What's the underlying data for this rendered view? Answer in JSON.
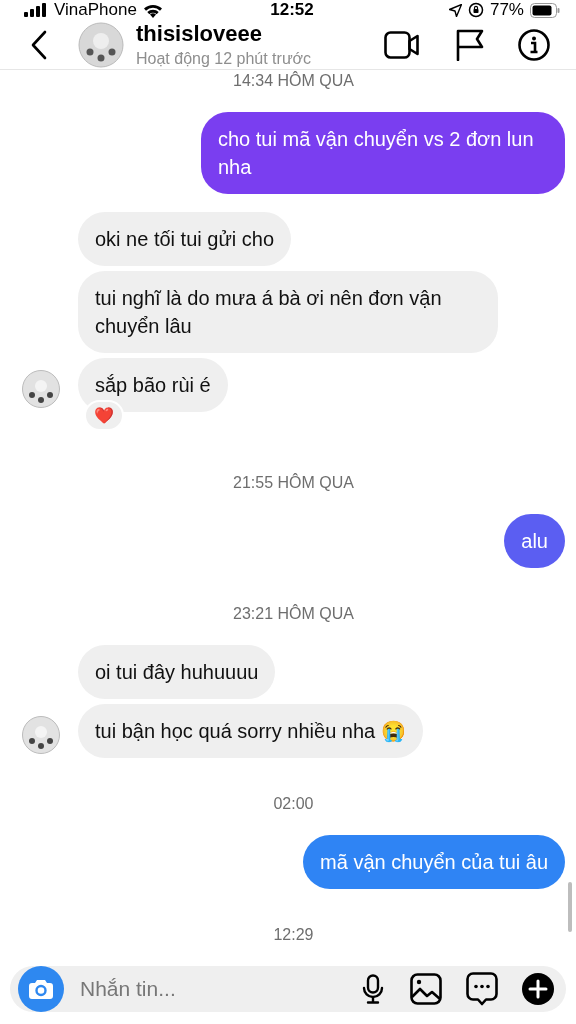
{
  "status_bar": {
    "carrier": "VinaPhone",
    "time": "12:52",
    "battery": "77%"
  },
  "header": {
    "name": "thisisloveee",
    "activity": "Hoạt động 12 phút trước"
  },
  "messages": [
    {
      "kind": "timestamp",
      "text": "14:34 HÔM QUA"
    },
    {
      "kind": "sent",
      "text": "cho tui mã vận chuyển vs 2 đơn lun nha",
      "color": "#7a3ef0"
    },
    {
      "kind": "received",
      "text": "oki ne tối tui gửi cho",
      "avatar": false
    },
    {
      "kind": "received",
      "text": "tui nghĩ là do mưa á bà ơi nên đơn vận chuyển lâu",
      "avatar": false
    },
    {
      "kind": "received",
      "text": "sắp bão rùi é",
      "avatar": true,
      "reaction": "❤️"
    },
    {
      "kind": "timestamp",
      "text": "21:55 HÔM QUA"
    },
    {
      "kind": "sent",
      "text": "alu",
      "color": "#5b5ef2"
    },
    {
      "kind": "timestamp",
      "text": "23:21 HÔM QUA"
    },
    {
      "kind": "received",
      "text": "oi tui đây huhuuuu",
      "avatar": false
    },
    {
      "kind": "received",
      "text": "tui bận học quá sorry nhiều nha 😭",
      "avatar": true
    },
    {
      "kind": "timestamp",
      "text": "02:00"
    },
    {
      "kind": "sent",
      "text": "mã vận chuyển của tui âu",
      "color": "#2f84f4"
    },
    {
      "kind": "timestamp",
      "text": "12:29"
    }
  ],
  "composer": {
    "placeholder": "Nhắn tin..."
  }
}
